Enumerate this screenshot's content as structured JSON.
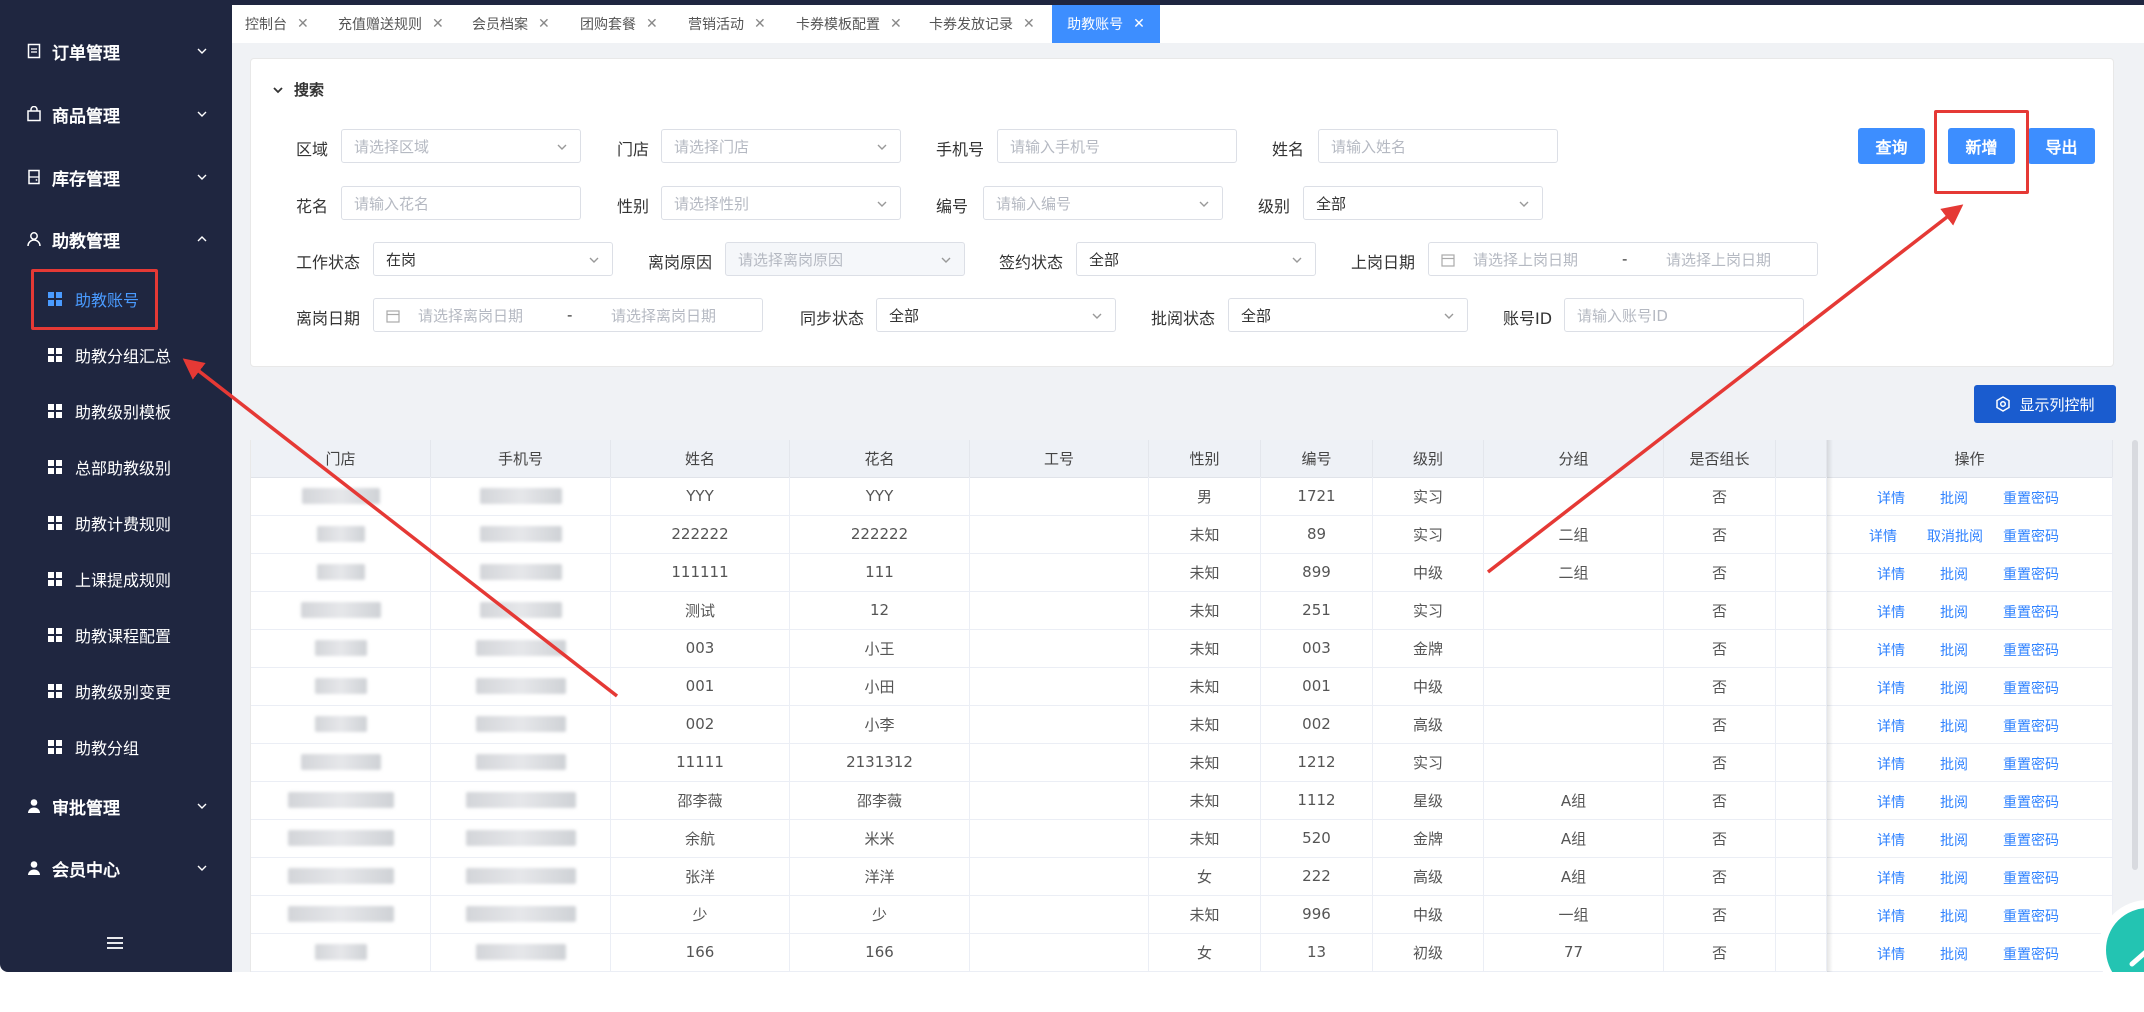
{
  "sidebar": {
    "groups": [
      {
        "label": "订单管理",
        "icon": "document-icon"
      },
      {
        "label": "商品管理",
        "icon": "bag-icon"
      },
      {
        "label": "库存管理",
        "icon": "inventory-icon"
      },
      {
        "label": "助教管理",
        "icon": "user-icon"
      },
      {
        "label": "审批管理",
        "icon": "approver-icon"
      },
      {
        "label": "会员中心",
        "icon": "member-icon"
      }
    ],
    "sub_items": [
      {
        "label": "助教账号",
        "active": true
      },
      {
        "label": "助教分组汇总"
      },
      {
        "label": "助教级别模板"
      },
      {
        "label": "总部助教级别"
      },
      {
        "label": "助教计费规则"
      },
      {
        "label": "上课提成规则"
      },
      {
        "label": "助教课程配置"
      },
      {
        "label": "助教级别变更"
      },
      {
        "label": "助教分组"
      }
    ]
  },
  "tabs": [
    {
      "label": "控制台"
    },
    {
      "label": "充值赠送规则"
    },
    {
      "label": "会员档案"
    },
    {
      "label": "团购套餐"
    },
    {
      "label": "营销活动"
    },
    {
      "label": "卡券模板配置"
    },
    {
      "label": "卡券发放记录"
    },
    {
      "label": "助教账号",
      "active": true
    }
  ],
  "search": {
    "title": "搜索",
    "fields": {
      "area": {
        "label": "区域",
        "placeholder": "请选择区域"
      },
      "store": {
        "label": "门店",
        "placeholder": "请选择门店"
      },
      "phone": {
        "label": "手机号",
        "placeholder": "请输入手机号"
      },
      "name": {
        "label": "姓名",
        "placeholder": "请输入姓名"
      },
      "nickname": {
        "label": "花名",
        "placeholder": "请输入花名"
      },
      "gender": {
        "label": "性别",
        "placeholder": "请选择性别"
      },
      "code": {
        "label": "编号",
        "placeholder": "请输入编号"
      },
      "level": {
        "label": "级别",
        "value": "全部"
      },
      "work_status": {
        "label": "工作状态",
        "value": "在岗"
      },
      "leave_reason": {
        "label": "离岗原因",
        "placeholder": "请选择离岗原因"
      },
      "sign_status": {
        "label": "签约状态",
        "value": "全部"
      },
      "onboard_date": {
        "label": "上岗日期",
        "start_placeholder": "请选择上岗日期",
        "separator": "-",
        "end_placeholder": "请选择上岗日期"
      },
      "leave_date": {
        "label": "离岗日期",
        "start_placeholder": "请选择离岗日期",
        "separator": "-",
        "end_placeholder": "请选择离岗日期"
      },
      "sync_status": {
        "label": "同步状态",
        "value": "全部"
      },
      "review_status": {
        "label": "批阅状态",
        "value": "全部"
      },
      "account_id": {
        "label": "账号ID",
        "placeholder": "请输入账号ID"
      }
    },
    "buttons": {
      "query": "查询",
      "add": "新增",
      "export": "导出"
    }
  },
  "column_control_label": "显示列控制",
  "table": {
    "headers": [
      "门店",
      "手机号",
      "姓名",
      "花名",
      "工号",
      "性别",
      "编号",
      "级别",
      "分组",
      "是否组长",
      "操作"
    ],
    "rows": [
      {
        "name": "YYY",
        "nickname": "YYY",
        "gender": "男",
        "code": "1721",
        "level": "实习",
        "group": "",
        "leader": "否",
        "ops": [
          "详情",
          "批阅",
          "重置密码"
        ]
      },
      {
        "name": "222222",
        "nickname": "222222",
        "gender": "未知",
        "code": "89",
        "level": "实习",
        "group": "二组",
        "leader": "否",
        "ops": [
          "详情",
          "取消批阅",
          "重置密码"
        ]
      },
      {
        "name": "111111",
        "nickname": "111",
        "gender": "未知",
        "code": "899",
        "level": "中级",
        "group": "二组",
        "leader": "否",
        "ops": [
          "详情",
          "批阅",
          "重置密码"
        ]
      },
      {
        "name": "测试",
        "nickname": "12",
        "gender": "未知",
        "code": "251",
        "level": "实习",
        "group": "",
        "leader": "否",
        "ops": [
          "详情",
          "批阅",
          "重置密码"
        ]
      },
      {
        "name": "003",
        "nickname": "小王",
        "gender": "未知",
        "code": "003",
        "level": "金牌",
        "group": "",
        "leader": "否",
        "ops": [
          "详情",
          "批阅",
          "重置密码"
        ]
      },
      {
        "name": "001",
        "nickname": "小田",
        "gender": "未知",
        "code": "001",
        "level": "中级",
        "group": "",
        "leader": "否",
        "ops": [
          "详情",
          "批阅",
          "重置密码"
        ]
      },
      {
        "name": "002",
        "nickname": "小李",
        "gender": "未知",
        "code": "002",
        "level": "高级",
        "group": "",
        "leader": "否",
        "ops": [
          "详情",
          "批阅",
          "重置密码"
        ]
      },
      {
        "name": "11111",
        "nickname": "2131312",
        "gender": "未知",
        "code": "1212",
        "level": "实习",
        "group": "",
        "leader": "否",
        "ops": [
          "详情",
          "批阅",
          "重置密码"
        ]
      },
      {
        "name": "邵李薇",
        "nickname": "邵李薇",
        "gender": "未知",
        "code": "1112",
        "level": "星级",
        "group": "A组",
        "leader": "否",
        "ops": [
          "详情",
          "批阅",
          "重置密码"
        ]
      },
      {
        "name": "余航",
        "nickname": "米米",
        "gender": "未知",
        "code": "520",
        "level": "金牌",
        "group": "A组",
        "leader": "否",
        "ops": [
          "详情",
          "批阅",
          "重置密码"
        ]
      },
      {
        "name": "张洋",
        "nickname": "洋洋",
        "gender": "女",
        "code": "222",
        "level": "高级",
        "group": "A组",
        "leader": "否",
        "ops": [
          "详情",
          "批阅",
          "重置密码"
        ]
      },
      {
        "name": "少",
        "nickname": "少",
        "gender": "未知",
        "code": "996",
        "level": "中级",
        "group": "一组",
        "leader": "否",
        "ops": [
          "详情",
          "批阅",
          "重置密码"
        ]
      },
      {
        "name": "166",
        "nickname": "166",
        "gender": "女",
        "code": "13",
        "level": "初级",
        "group": "77",
        "leader": "否",
        "ops": [
          "详情",
          "批阅",
          "重置密码"
        ]
      }
    ]
  },
  "colors": {
    "sidebar_bg": "#1f2640",
    "accent": "#3d8eff",
    "link": "#2f82ff",
    "annotation_red": "#e53935",
    "fab": "#23c4b2"
  }
}
